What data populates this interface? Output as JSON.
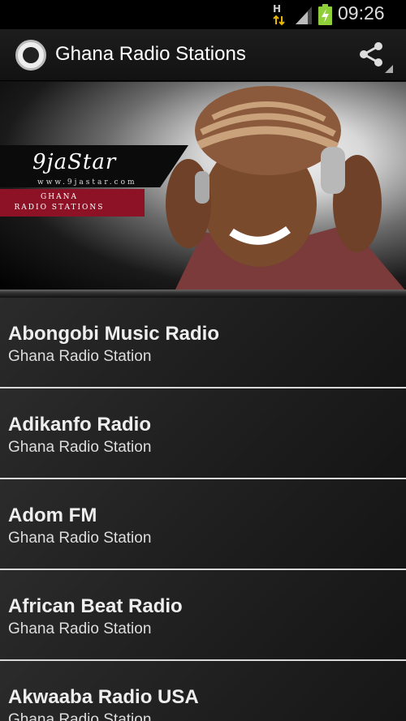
{
  "status_bar": {
    "network": "H",
    "time": "09:26"
  },
  "app": {
    "title": "Ghana Radio Stations"
  },
  "actions": {
    "share_icon": "share-icon"
  },
  "banner": {
    "brand_name": "9jaStar",
    "brand_url": "www.9jastar.com",
    "ribbon_line1": "GHANA",
    "ribbon_line2": "RADIO STATIONS",
    "accent_color": "#8d1226"
  },
  "stations": [
    {
      "name": "Abongobi Music Radio",
      "subtitle": "Ghana Radio Station"
    },
    {
      "name": "Adikanfo Radio",
      "subtitle": "Ghana Radio Station"
    },
    {
      "name": "Adom FM",
      "subtitle": "Ghana Radio Station"
    },
    {
      "name": "African Beat Radio",
      "subtitle": "Ghana Radio Station"
    },
    {
      "name": "Akwaaba Radio USA",
      "subtitle": "Ghana Radio Station"
    }
  ]
}
